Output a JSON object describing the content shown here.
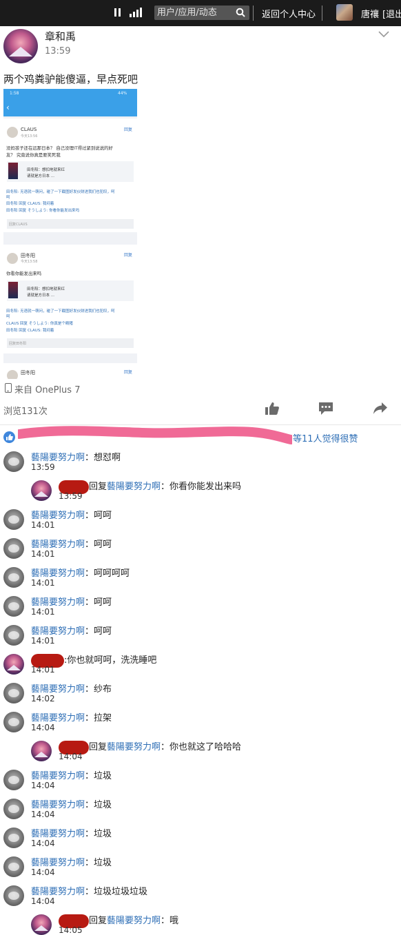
{
  "topbar": {
    "search_placeholder": "用户/应用/动态",
    "personal_center": "返回个人中心",
    "username": "唐禳",
    "logout": "[退出"
  },
  "post": {
    "author": "章和禹",
    "time": "13:59",
    "text": "两个鸡粪驴能傻逼，早点死吧",
    "source": "来自 OnePlus 7",
    "views": "浏览131次"
  },
  "screenshot": {
    "status_time": "1:58",
    "status_battery": "44%",
    "card1": {
      "name": "CLAUS",
      "time": "今天13:56",
      "reply": "回复",
      "body_1": "没妈孩子还在远那日本？ 自己没理IT得过紧到说说的好",
      "body_2": "友？ 究竟说你真是要笑死我",
      "quote_1": "田冬阳：想扣地就来红",
      "quote_2": "请就是方日本 ...",
      "line_1": "田冬阳: 无语就一萌问，碰了一下截图好发伙财进我们也犯叹，呵",
      "line_1b": "呵",
      "line_2": "田冬阳 回复 CLAUS: 我闷着",
      "line_3": "田冬阳 回复 そうしよう: 你看你能发出来吗",
      "reply_box": "回复CLAUS"
    },
    "card2": {
      "name": "田冬阳",
      "time": "今天13:58",
      "reply": "回复",
      "body": "你看你能发出来吗",
      "quote_1": "田冬阳：想扣地就来红",
      "quote_2": "请就是方日本 ...",
      "line_1": "田冬阳: 无语就一萌问，碰了一下截图好发伙财进我们也犯叹，呵",
      "line_1b": "呵",
      "line_2": "CLAUS 回复 そうしよう: 你真是个精猪",
      "line_3": "田冬阳 回复 CLAUS: 我闷着",
      "reply_box": "回复田冬阳"
    },
    "card3": {
      "name": "田冬阳",
      "reply": "回复"
    }
  },
  "likes": {
    "tail": "等11人觉得很赞"
  },
  "comments": [
    {
      "type": "top",
      "author": "藝陽要努力啊",
      "text": "：想怼啊",
      "time": "13:59",
      "avatar": "gray"
    },
    {
      "type": "reply",
      "reply_word": "回复",
      "target": "藝陽要努力啊",
      "text": "：你看你能发出来吗",
      "time": "13:59",
      "avatar": "pink"
    },
    {
      "type": "top",
      "author": "藝陽要努力啊",
      "text": "：呵呵",
      "time": "14:01",
      "avatar": "gray"
    },
    {
      "type": "top",
      "author": "藝陽要努力啊",
      "text": "：呵呵",
      "time": "14:01",
      "avatar": "gray"
    },
    {
      "type": "top",
      "author": "藝陽要努力啊",
      "text": "：呵呵呵呵",
      "time": "14:01",
      "avatar": "gray"
    },
    {
      "type": "top",
      "author": "藝陽要努力啊",
      "text": "：呵呵",
      "time": "14:01",
      "avatar": "gray"
    },
    {
      "type": "top",
      "author": "藝陽要努力啊",
      "text": "：呵呵",
      "time": "14:01",
      "avatar": "gray"
    },
    {
      "type": "top_redacted",
      "author": "",
      "text": ":你也就呵呵，洗洗睡吧",
      "time": "14:01",
      "avatar": "pink"
    },
    {
      "type": "top",
      "author": "藝陽要努力啊",
      "text": "：纱布",
      "time": "14:02",
      "avatar": "gray"
    },
    {
      "type": "top",
      "author": "藝陽要努力啊",
      "text": "：拉架",
      "time": "14:04",
      "avatar": "gray"
    },
    {
      "type": "reply",
      "reply_word": "回复",
      "target": "藝陽要努力啊",
      "text": "：你也就这了哈哈哈",
      "time": "14:04",
      "avatar": "pink"
    },
    {
      "type": "top",
      "author": "藝陽要努力啊",
      "text": "：垃圾",
      "time": "14:04",
      "avatar": "gray"
    },
    {
      "type": "top",
      "author": "藝陽要努力啊",
      "text": "：垃圾",
      "time": "14:04",
      "avatar": "gray"
    },
    {
      "type": "top",
      "author": "藝陽要努力啊",
      "text": "：垃圾",
      "time": "14:04",
      "avatar": "gray"
    },
    {
      "type": "top",
      "author": "藝陽要努力啊",
      "text": "：垃圾",
      "time": "14:04",
      "avatar": "gray"
    },
    {
      "type": "top",
      "author": "藝陽要努力啊",
      "text": "：垃圾垃圾垃圾",
      "time": "14:04",
      "avatar": "gray"
    },
    {
      "type": "reply",
      "reply_word": "回复",
      "target": "藝陽要努力啊",
      "text": "：哦",
      "time": "14:05",
      "avatar": "pink"
    }
  ],
  "colors": {
    "topbar": "#1b1b1b",
    "link_blue": "#2f6fb6",
    "redaction": "#b71a12",
    "scribble": "#f06a96"
  }
}
